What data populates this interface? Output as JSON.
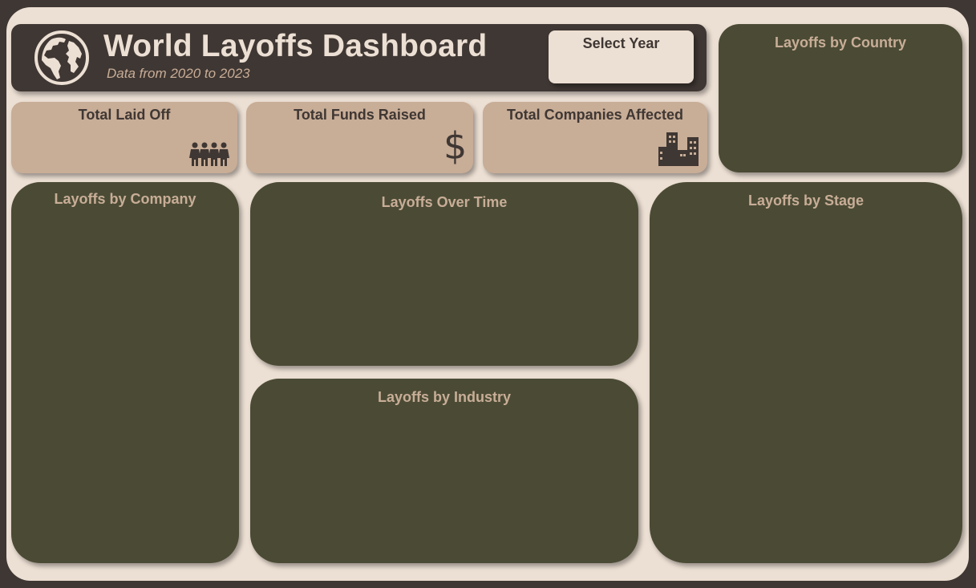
{
  "header": {
    "title": "World Layoffs Dashboard",
    "subtitle": "Data from 2020 to 2023"
  },
  "filter": {
    "year_label": "Select Year"
  },
  "kpis": [
    {
      "label": "Total Laid Off",
      "icon": "people-icon"
    },
    {
      "label": "Total Funds Raised",
      "icon": "dollar-icon"
    },
    {
      "label": "Total Companies Affected",
      "icon": "buildings-icon"
    }
  ],
  "panels": {
    "country": "Layoffs by Country",
    "company": "Layoffs by Company",
    "over_time": "Layoffs Over Time",
    "stage": "Layoffs by Stage",
    "industry": "Layoffs by Industry"
  },
  "colors": {
    "dark_brown": "#3f3733",
    "cream": "#ecdfd3",
    "tan": "#c8ad97",
    "olive": "#4b4b35"
  }
}
